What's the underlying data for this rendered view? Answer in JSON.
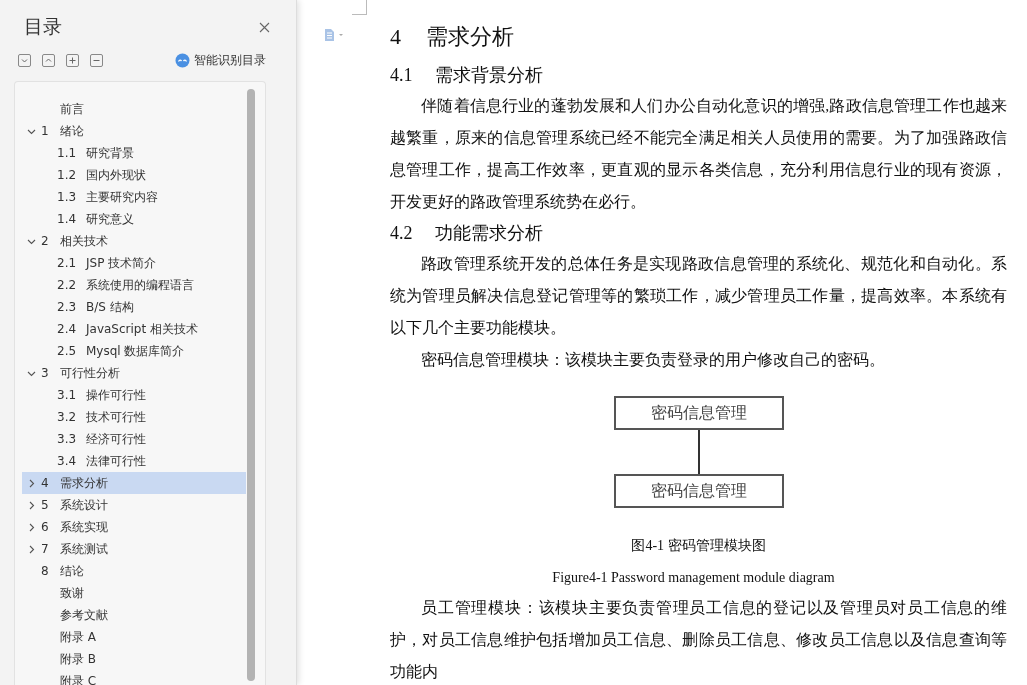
{
  "sidebar": {
    "title": "目录",
    "smart_button": {
      "label": "智能识别目录"
    },
    "toc": [
      {
        "title": "前言",
        "selected": false
      },
      {
        "number": "1",
        "title": "绪论",
        "expanded": true,
        "selected": false,
        "children": [
          {
            "number": "1.1",
            "title": "研究背景",
            "selected": false
          },
          {
            "number": "1.2",
            "title": "国内外现状",
            "selected": false
          },
          {
            "number": "1.3",
            "title": "主要研究内容",
            "selected": false
          },
          {
            "number": "1.4",
            "title": "研究意义",
            "selected": false
          }
        ]
      },
      {
        "number": "2",
        "title": "相关技术",
        "expanded": true,
        "selected": false,
        "children": [
          {
            "number": "2.1",
            "title": "JSP 技术简介",
            "selected": false
          },
          {
            "number": "2.2",
            "title": "系统使用的编程语言",
            "selected": false
          },
          {
            "number": "2.3",
            "title": "B/S 结构",
            "selected": false
          },
          {
            "number": "2.4",
            "title": "JavaScript 相关技术",
            "selected": false
          },
          {
            "number": "2.5",
            "title": "Mysql 数据库简介",
            "selected": false
          }
        ]
      },
      {
        "number": "3",
        "title": "可行性分析",
        "expanded": true,
        "selected": false,
        "children": [
          {
            "number": "3.1",
            "title": "操作可行性",
            "selected": false
          },
          {
            "number": "3.2",
            "title": "技术可行性",
            "selected": false
          },
          {
            "number": "3.3",
            "title": "经济可行性",
            "selected": false
          },
          {
            "number": "3.4",
            "title": "法律可行性",
            "selected": false
          }
        ]
      },
      {
        "number": "4",
        "title": "需求分析",
        "expanded": false,
        "selected": true
      },
      {
        "number": "5",
        "title": "系统设计",
        "expanded": false,
        "selected": false
      },
      {
        "number": "6",
        "title": "系统实现",
        "expanded": false,
        "selected": false
      },
      {
        "number": "7",
        "title": "系统测试",
        "expanded": false,
        "selected": false
      },
      {
        "number": "8",
        "title": "结论",
        "selected": false
      },
      {
        "title": "致谢",
        "selected": false
      },
      {
        "title": "参考文献",
        "selected": false
      },
      {
        "title": "附录 A",
        "selected": false
      },
      {
        "title": "附录 B",
        "selected": false
      },
      {
        "title": "附录 C",
        "selected": false
      }
    ]
  },
  "document": {
    "blocks": [
      {
        "kind": "h1",
        "number": "4",
        "text": "需求分析"
      },
      {
        "kind": "h2",
        "number": "4.1",
        "text": "需求背景分析"
      },
      {
        "kind": "p",
        "text": "伴随着信息行业的蓬勃发展和人们办公自动化意识的增强,路政信息管理工作也越来越繁重，原来的信息管理系统已经不能完全满足相关人员使用的需要。为了加强路政信息管理工作，提高工作效率，更直观的显示各类信息，充分利用信息行业的现有资源，开发更好的路政管理系统势在必行。"
      },
      {
        "kind": "h2",
        "number": "4.2",
        "text": "功能需求分析"
      },
      {
        "kind": "p",
        "text": "路政管理系统开发的总体任务是实现路政信息管理的系统化、规范化和自动化。系统为管理员解决信息登记管理等的繁琐工作，减少管理员工作量，提高效率。本系统有以下几个主要功能模块。"
      },
      {
        "kind": "p",
        "text": "密码信息管理模块：该模块主要负责登录的用户修改自己的密码。"
      },
      {
        "kind": "figure",
        "boxes": [
          "密码信息管理",
          "密码信息管理"
        ],
        "caption": "图4-1 密码管理模块图",
        "caption_en": "Figure4-1 Password management module diagram"
      },
      {
        "kind": "p",
        "text": "员工管理模块：该模块主要负责管理员工信息的登记以及管理员对员工信息的维护，对员工信息维护包括增加员工信息、删除员工信息、修改员工信息以及信息查询等功能内"
      }
    ]
  }
}
